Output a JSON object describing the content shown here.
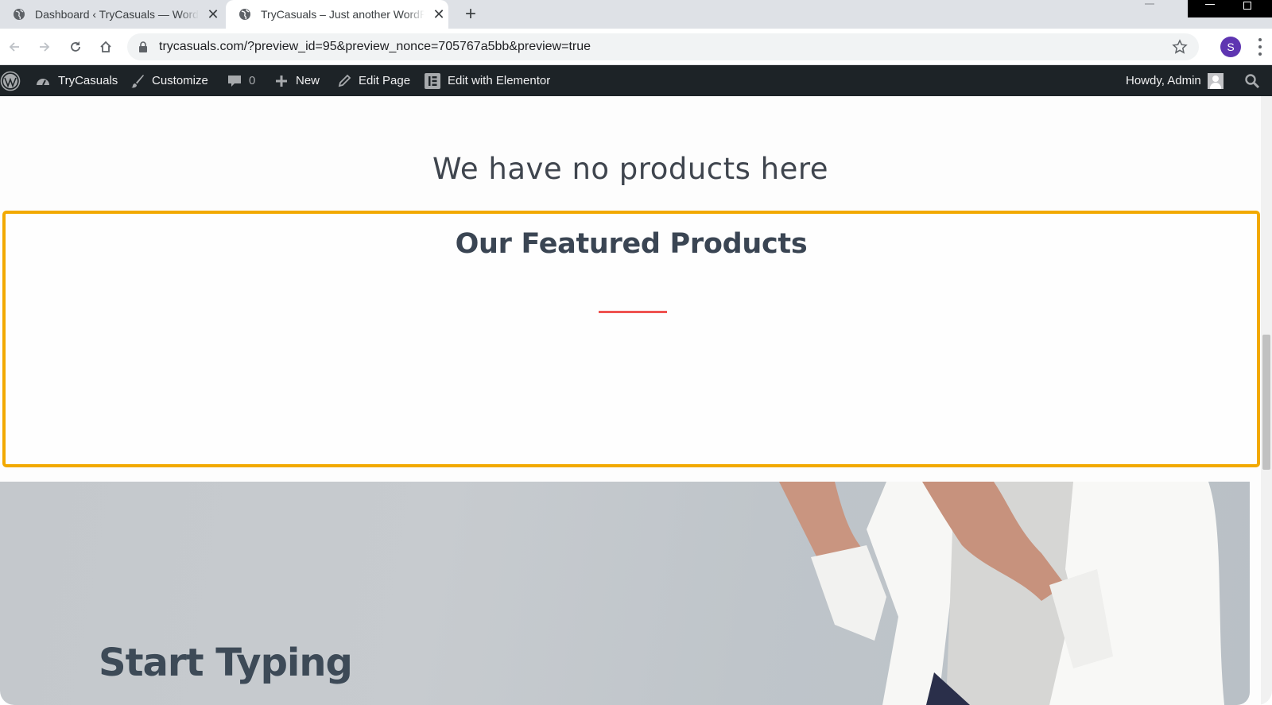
{
  "browser": {
    "tabs": [
      {
        "title": "Dashboard ‹ TryCasuals — WordPress",
        "active": false
      },
      {
        "title": "TryCasuals – Just another WordPress site",
        "active": true
      }
    ],
    "close_glyph": "✕",
    "new_tab_glyph": "+",
    "url": "trycasuals.com/?preview_id=95&preview_nonce=705767a5bb&preview=true",
    "profile_initial": "S",
    "profile_color": "#5e35b1"
  },
  "admin_bar": {
    "site_name": "TryCasuals",
    "customize": "Customize",
    "comments_count": "0",
    "new": "New",
    "edit_page": "Edit Page",
    "edit_elementor": "Edit with Elementor",
    "greeting": "Howdy, Admin",
    "background": "#1d2327"
  },
  "content": {
    "no_products": "We have no products here",
    "featured_title": "Our Featured Products",
    "hero_title": "Start Typing",
    "highlight_color": "#f2a900",
    "divider_color": "#ef5350"
  }
}
